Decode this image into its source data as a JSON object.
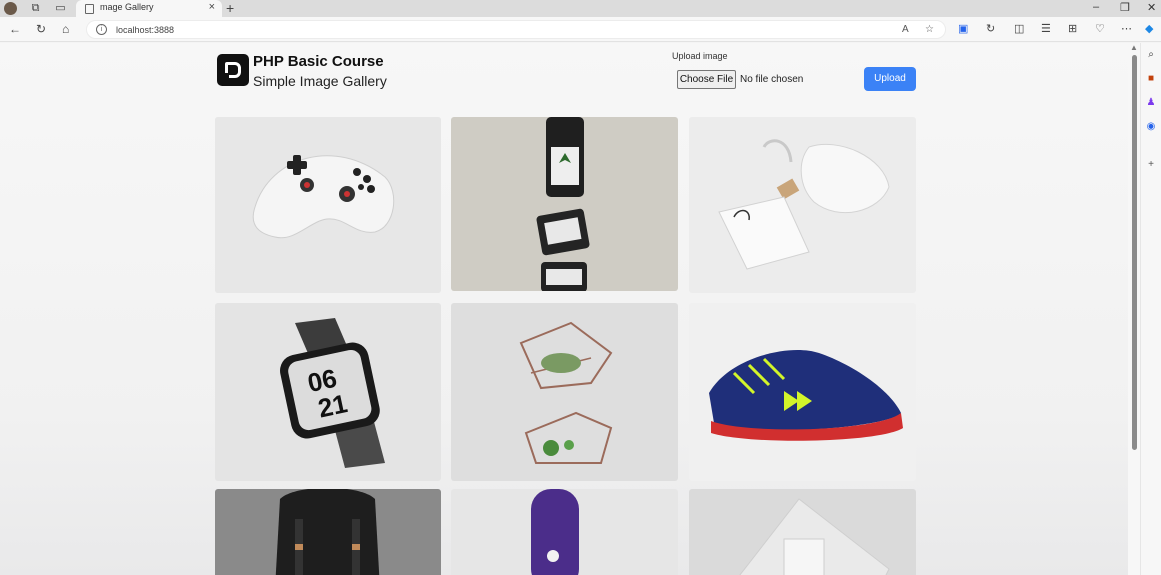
{
  "browser": {
    "tab_title": "mage Gallery",
    "address": "localhost:3888",
    "new_tab_symbol": "+",
    "tab_close_symbol": "×"
  },
  "header": {
    "title": "PHP Basic Course",
    "subtitle": "Simple Image Gallery",
    "upload_label": "Upload image",
    "choose_file": "Choose File",
    "no_file": "No file chosen",
    "upload_button": "Upload"
  },
  "gallery": {
    "images": [
      {
        "subject": "game-controller"
      },
      {
        "subject": "serum-bottle-and-jars"
      },
      {
        "subject": "cotton-pouch-and-tag"
      },
      {
        "subject": "smart-watch"
      },
      {
        "subject": "geometric-planters"
      },
      {
        "subject": "running-shoe"
      },
      {
        "subject": "black-backpack"
      },
      {
        "subject": "purple-hair-dryer"
      },
      {
        "subject": "cosmetic-box"
      }
    ]
  },
  "colors": {
    "accent": "#3b82f6"
  }
}
